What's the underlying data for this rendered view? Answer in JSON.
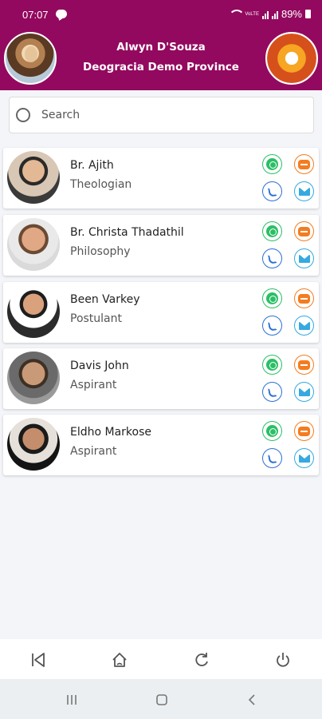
{
  "status_bar": {
    "time": "07:07",
    "battery": "89%",
    "network_small_text": "VoLTE"
  },
  "header": {
    "user_name": "Alwyn D'Souza",
    "province": "Deogracia Demo Province",
    "left_avatar_icon": "jesus-portrait",
    "right_avatar_icon": "holy-spirit-dove-logo"
  },
  "search": {
    "placeholder": "Search",
    "value": ""
  },
  "contacts": [
    {
      "name": "Br. Ajith",
      "role": "Theologian"
    },
    {
      "name": "Br. Christa Thadathil",
      "role": "Philosophy"
    },
    {
      "name": "Been Varkey",
      "role": "Postulant"
    },
    {
      "name": "Davis John",
      "role": "Aspirant"
    },
    {
      "name": "Eldho Markose",
      "role": "Aspirant"
    }
  ],
  "actions": {
    "whatsapp_icon": "whatsapp-icon",
    "message_icon": "chat-bubble-icon",
    "call_icon": "phone-icon",
    "mail_icon": "mail-icon"
  },
  "bottom_nav": [
    "back",
    "home",
    "refresh",
    "power"
  ],
  "colors": {
    "header": "#93095f",
    "whatsapp": "#2bbf66",
    "message": "#f47c20",
    "call": "#2b6fd6",
    "mail": "#35a9e0"
  }
}
